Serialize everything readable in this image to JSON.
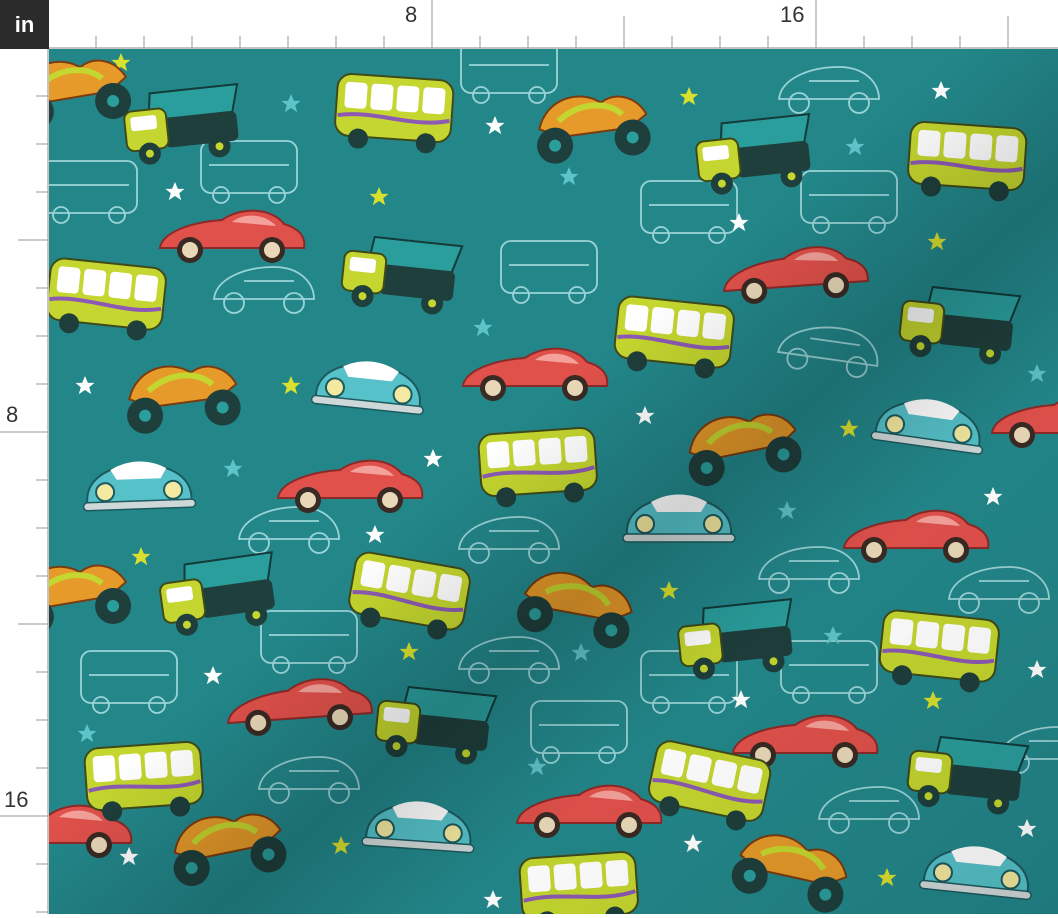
{
  "ruler": {
    "unit": "in",
    "top_labels": [
      "8",
      "16"
    ],
    "left_labels": [
      "8",
      "16"
    ]
  },
  "fabric": {
    "background": "#23878a",
    "motifs": {
      "palette": {
        "red": "#e0514b",
        "yellow_green": "#c4d62f",
        "teal_light": "#56c1c9",
        "dark": "#1f3f3c",
        "outline": "#a9dde0",
        "star_yellow": "#d9e02e",
        "star_white": "#ffffff",
        "star_teal": "#5fc4c9"
      },
      "icons": [
        "race-car-icon",
        "bus-icon",
        "dump-truck-icon",
        "beetle-car-icon",
        "motorbike-icon",
        "star-icon"
      ]
    }
  }
}
